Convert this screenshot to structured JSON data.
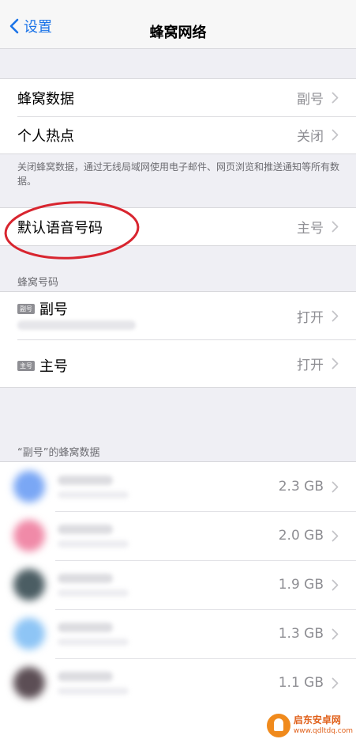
{
  "nav": {
    "back_label": "设置",
    "title": "蜂窝网络"
  },
  "cellular_group": {
    "items": [
      {
        "label": "蜂窝数据",
        "value": "副号"
      },
      {
        "label": "个人热点",
        "value": "关闭"
      }
    ]
  },
  "cellular_note": "关闭蜂窝数据，通过无线局域网使用电子邮件、网页浏览和推送通知等所有数据。",
  "voice_group": {
    "label": "默认语音号码",
    "value": "主号"
  },
  "sim_section": {
    "header": "蜂窝号码",
    "items": [
      {
        "badge": "副号",
        "name": "副号",
        "value": "打开"
      },
      {
        "badge": "主号",
        "name": "主号",
        "value": "打开"
      }
    ]
  },
  "usage_section": {
    "header": "“副号”的蜂窝数据",
    "apps": [
      {
        "usage": "2.3 GB",
        "icon_color": "#7aa7f5"
      },
      {
        "usage": "2.0 GB",
        "icon_color": "#f08aa8"
      },
      {
        "usage": "1.9 GB",
        "icon_color": "#4b5d63"
      },
      {
        "usage": "1.3 GB",
        "icon_color": "#8ec5f5"
      },
      {
        "usage": "1.1 GB",
        "icon_color": "#5c4e55"
      }
    ]
  },
  "watermark": {
    "name": "启东安卓网",
    "url": "www.qdltdq.com"
  },
  "colors": {
    "accent": "#1a73e8",
    "annotation": "#d8252f"
  }
}
